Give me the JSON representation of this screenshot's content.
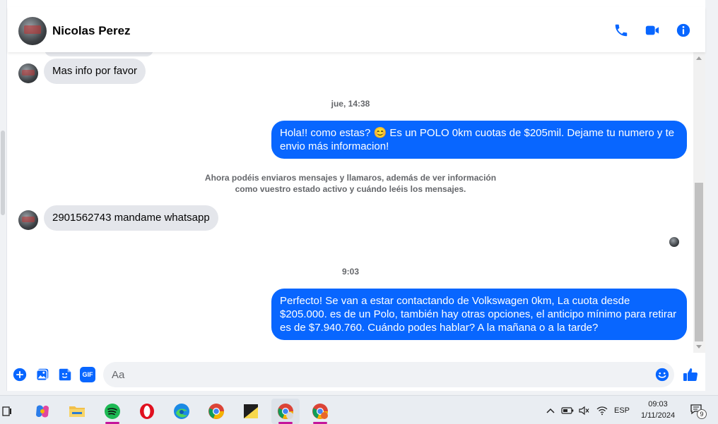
{
  "header": {
    "contact_name": "Nicolas Perez",
    "icons": [
      "phone-icon",
      "video-camera-icon",
      "info-icon"
    ]
  },
  "messages": {
    "incoming_1": "Mas info por favor",
    "timestamp_1": "jue, 14:38",
    "outgoing_1": "Hola!! como estas? 😊 Es un POLO 0km cuotas de $205mil. Dejame tu numero y te envio más informacion!",
    "notice": "Ahora podéis enviaros mensajes y llamaros, además de ver información como vuestro estado activo y cuándo leéis los mensajes.",
    "incoming_2": "2901562743 mandame whatsapp",
    "timestamp_2": "9:03",
    "outgoing_2": "Perfecto!  Se van a estar contactando de Volkswagen 0km, La cuota desde $205.000. es de un Polo, también hay otras opciones, el anticipo mínimo para retirar es de $7.940.760. Cuándo podes hablar? A la mañana o a la tarde?"
  },
  "composer": {
    "placeholder": "Aa",
    "icons": [
      "plus-circle-icon",
      "gallery-icon",
      "sticker-icon",
      "gif-icon",
      "emoji-icon",
      "thumbs-up-icon"
    ],
    "gif_label": "GIF"
  },
  "taskbar": {
    "apps": [
      "task-view-icon",
      "copilot-icon",
      "file-explorer-icon",
      "spotify-icon",
      "opera-icon",
      "edge-icon",
      "chrome-icon",
      "sticky-notes-icon",
      "chrome-profile-icon",
      "chrome-profile-2-icon"
    ],
    "language": "ESP",
    "time": "09:03",
    "date": "1/11/2024",
    "notification_count": "9"
  },
  "colors": {
    "accent": "#0866ff",
    "incoming_bubble": "#e4e6eb"
  }
}
